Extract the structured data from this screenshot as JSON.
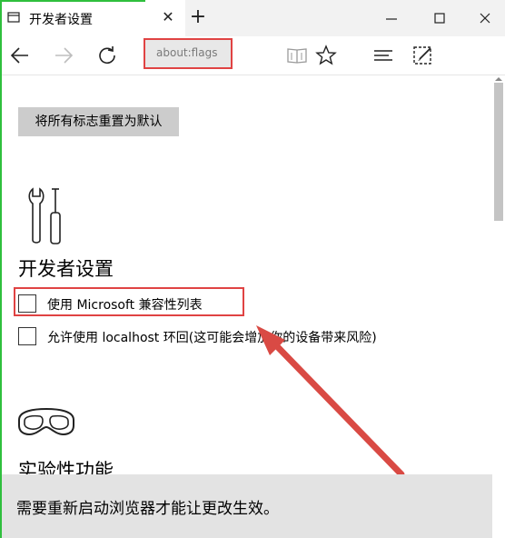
{
  "tab": {
    "title": "开发者设置",
    "close_glyph": "✕",
    "new_tab_glyph": "+"
  },
  "address": {
    "value": "about:flags"
  },
  "reset_button": {
    "label": "将所有标志重置为默认"
  },
  "developer_section": {
    "title": "开发者设置",
    "options": [
      {
        "label": "使用 Microsoft 兼容性列表",
        "checked": false
      },
      {
        "label": "允许使用 localhost 环回(这可能会增加你的设备带来风险)",
        "checked": false
      }
    ]
  },
  "experimental_section": {
    "title": "实验性功能"
  },
  "notification": {
    "text": "需要重新启动浏览器才能让更改生效。"
  },
  "colors": {
    "highlight": "#e04343",
    "arrow": "#d94a44",
    "accent_green": "#2fbf3d"
  }
}
